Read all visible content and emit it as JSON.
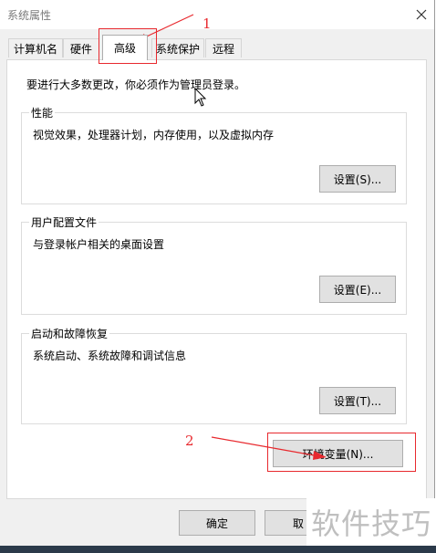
{
  "window": {
    "title": "系统属性",
    "close_icon": "close-icon"
  },
  "tabs": [
    {
      "label": "计算机名",
      "active": false
    },
    {
      "label": "硬件",
      "active": false
    },
    {
      "label": "高级",
      "active": true
    },
    {
      "label": "系统保护",
      "active": false
    },
    {
      "label": "远程",
      "active": false
    }
  ],
  "advanced": {
    "admin_note": "要进行大多数更改，你必须作为管理员登录。",
    "performance": {
      "legend": "性能",
      "description": "视觉效果，处理器计划，内存使用，以及虚拟内存",
      "button_label": "设置(S)..."
    },
    "user_profiles": {
      "legend": "用户配置文件",
      "description": "与登录帐户相关的桌面设置",
      "button_label": "设置(E)..."
    },
    "startup_recovery": {
      "legend": "启动和故障恢复",
      "description": "系统启动、系统故障和调试信息",
      "button_label": "设置(T)..."
    },
    "env_vars_button_label": "环境变量(N)..."
  },
  "footer": {
    "ok_label": "确定",
    "cancel_label": "取"
  },
  "annotations": {
    "marker_1": "1",
    "marker_2": "2",
    "color": "#e8292e"
  },
  "watermark": "软件技巧"
}
